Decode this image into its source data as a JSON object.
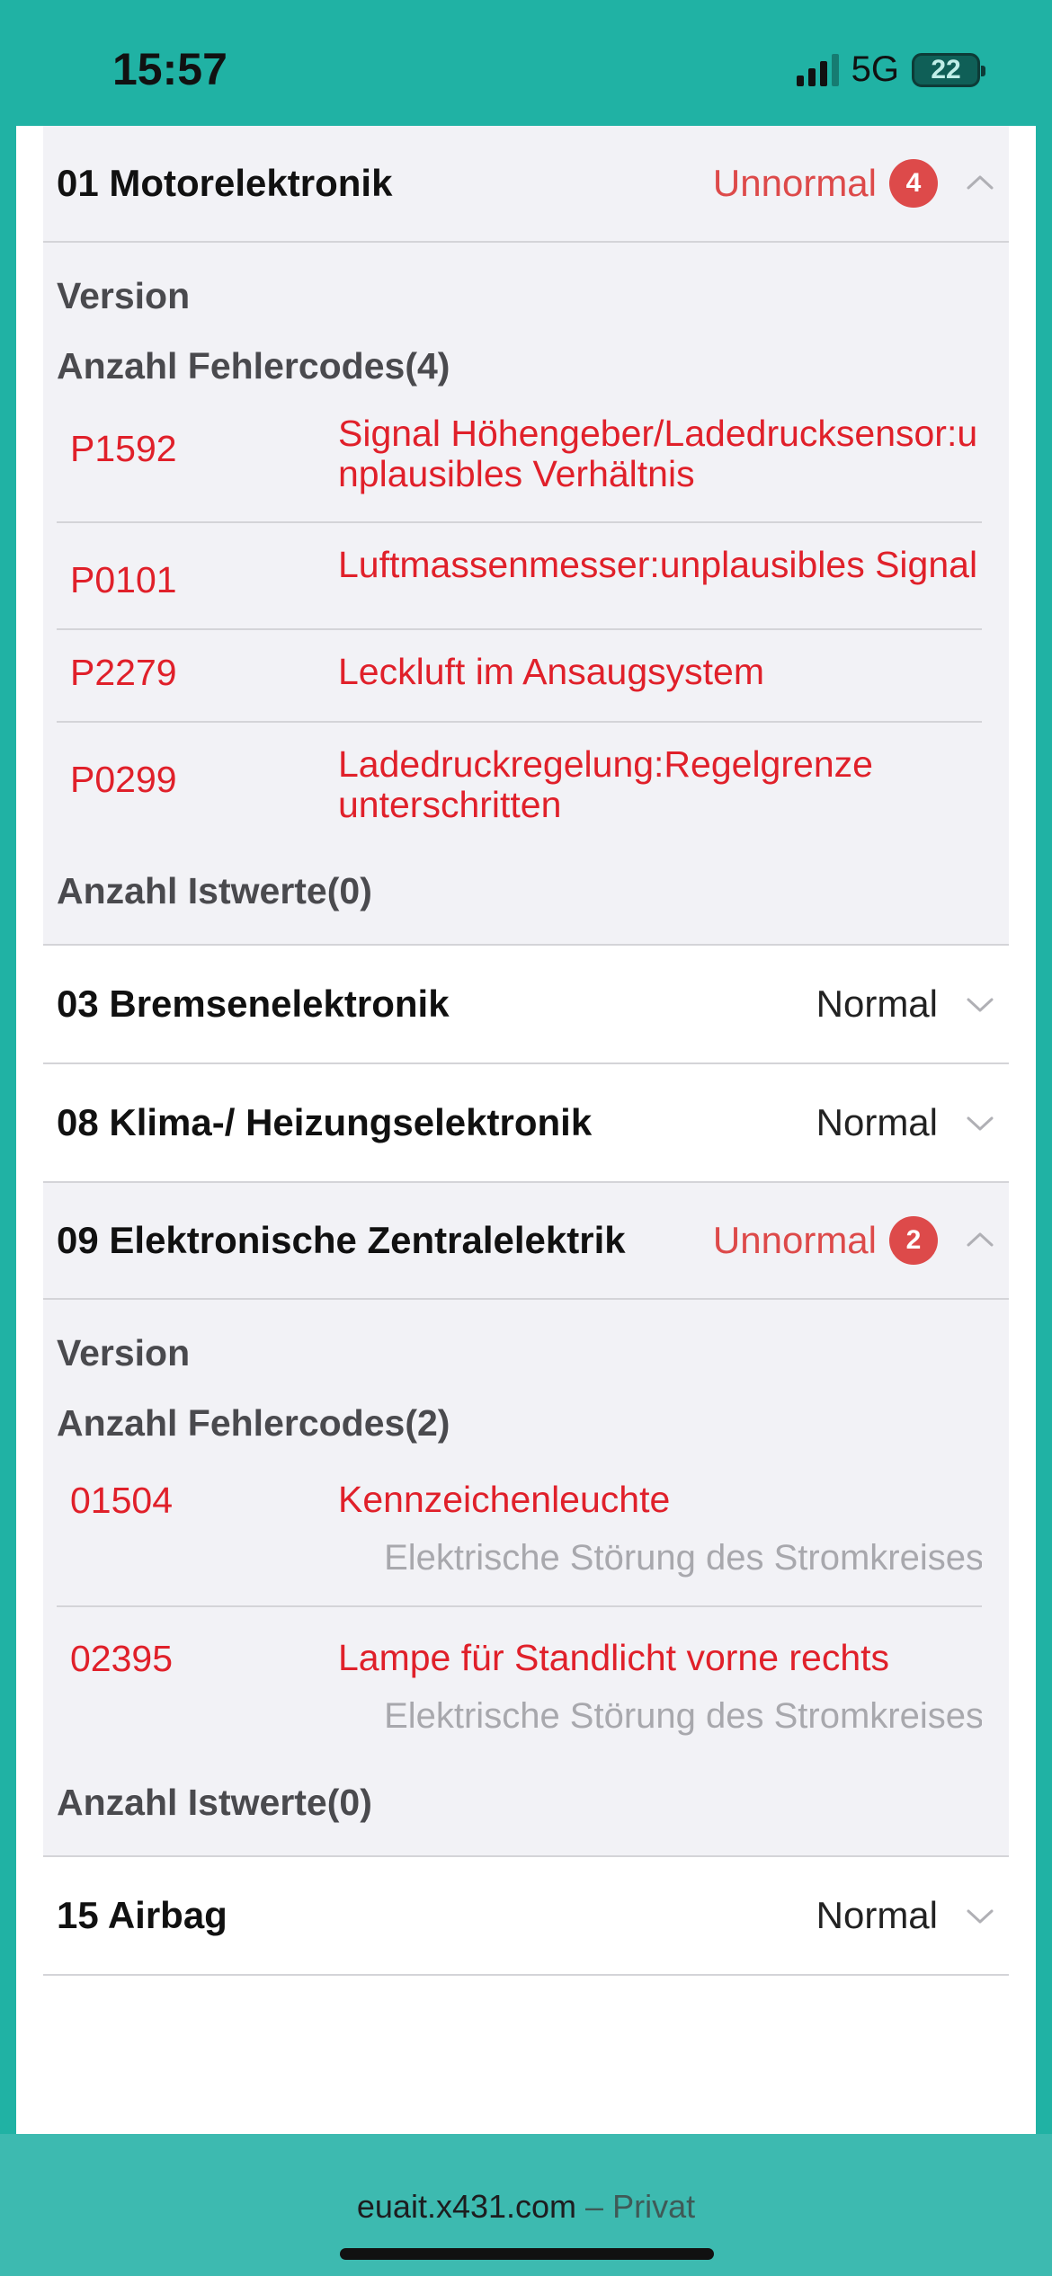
{
  "status_bar": {
    "time": "15:57",
    "network": "5G",
    "battery": "22"
  },
  "modules": [
    {
      "title": "01 Motorelektronik",
      "status": "Unnormal",
      "count": "4",
      "expanded": true,
      "version_label": "Version",
      "faults_label": "Anzahl Fehlercodes(4)",
      "faults": [
        {
          "code": "P1592",
          "desc": "Signal Höhengeber/Ladedrucksensor:unplausibles Verhältnis"
        },
        {
          "code": "P0101",
          "desc": "Luftmassenmesser:unplausibles Signal"
        },
        {
          "code": "P2279",
          "desc": "Leckluft im Ansaugsystem"
        },
        {
          "code": "P0299",
          "desc": "Ladedruckregelung:Regelgrenze unterschritten"
        }
      ],
      "values_label": "Anzahl Istwerte(0)"
    },
    {
      "title": "03 Bremsenelektronik",
      "status": "Normal",
      "expanded": false
    },
    {
      "title": "08 Klima-/ Heizungselektronik",
      "status": "Normal",
      "expanded": false
    },
    {
      "title": "09 Elektronische Zentralelektrik",
      "status": "Unnormal",
      "count": "2",
      "expanded": true,
      "version_label": "Version",
      "faults_label": "Anzahl Fehlercodes(2)",
      "faults": [
        {
          "code": "01504",
          "desc": "Kennzeichenleuchte",
          "sub": "Elektrische Störung des Stromkreises"
        },
        {
          "code": "02395",
          "desc": "Lampe für Standlicht vorne rechts",
          "sub": "Elektrische Störung des Stromkreises"
        }
      ],
      "values_label": "Anzahl Istwerte(0)"
    },
    {
      "title": "15 Airbag",
      "status": "Normal",
      "expanded": false
    }
  ],
  "browser": {
    "host": "euait.x431.com",
    "separator": "–",
    "mode": "Privat"
  },
  "colors": {
    "accent_teal": "#20b2a4",
    "error_red": "#e0202a",
    "badge_red": "#dd4a4a"
  }
}
